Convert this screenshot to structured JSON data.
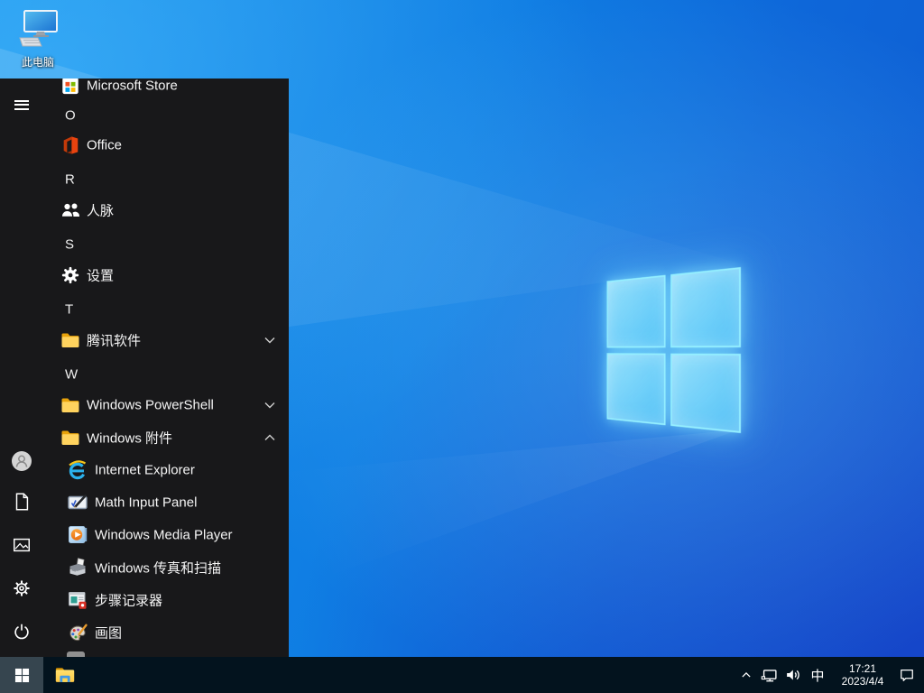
{
  "desktop": {
    "this_pc_label": "此电脑",
    "wallpaper": "windows10-light-blue-hero",
    "colors": {
      "base_blue": "#0f7de3",
      "logo_border": "#96f0ff",
      "dark_corner": "#173ec6"
    }
  },
  "start_menu": {
    "colors": {
      "background": "#18181a",
      "text": "#f5f5f5"
    },
    "rail": [
      {
        "icon": "hamburger-menu-icon"
      },
      {
        "icon": "user-avatar-icon"
      },
      {
        "icon": "documents-icon"
      },
      {
        "icon": "pictures-icon"
      },
      {
        "icon": "settings-gear-icon"
      },
      {
        "icon": "power-icon"
      }
    ],
    "items": [
      {
        "type": "app",
        "label": "Microsoft Store",
        "icon": "microsoft-store-icon"
      },
      {
        "type": "section",
        "label": "O"
      },
      {
        "type": "app",
        "label": "Office",
        "icon": "office-icon"
      },
      {
        "type": "section",
        "label": "R"
      },
      {
        "type": "app",
        "label": "人脉",
        "icon": "people-icon"
      },
      {
        "type": "section",
        "label": "S"
      },
      {
        "type": "app",
        "label": "设置",
        "icon": "settings-icon"
      },
      {
        "type": "section",
        "label": "T"
      },
      {
        "type": "folder",
        "label": "腾讯软件",
        "icon": "folder-icon",
        "state": "collapsed"
      },
      {
        "type": "section",
        "label": "W"
      },
      {
        "type": "folder",
        "label": "Windows PowerShell",
        "icon": "folder-icon",
        "state": "collapsed"
      },
      {
        "type": "folder",
        "label": "Windows 附件",
        "icon": "folder-icon",
        "state": "expanded"
      },
      {
        "type": "app",
        "label": "Internet Explorer",
        "icon": "internet-explorer-icon",
        "indent": true
      },
      {
        "type": "app",
        "label": "Math Input Panel",
        "icon": "math-input-panel-icon",
        "indent": true
      },
      {
        "type": "app",
        "label": "Windows Media Player",
        "icon": "windows-media-player-icon",
        "indent": true
      },
      {
        "type": "app",
        "label": "Windows 传真和扫描",
        "icon": "fax-and-scan-icon",
        "indent": true
      },
      {
        "type": "app",
        "label": "步骤记录器",
        "icon": "steps-recorder-icon",
        "indent": true
      },
      {
        "type": "app",
        "label": "画图",
        "icon": "paint-icon",
        "indent": true
      }
    ]
  },
  "taskbar": {
    "colors": {
      "background": "#03131e",
      "start_button_active": "#36454f"
    },
    "flag_colors": [
      "#f25022",
      "#7fba00",
      "#00a4ef",
      "#ffb900"
    ],
    "tray": {
      "ime_label": "中",
      "time": "17:21",
      "date": "2023/4/4"
    }
  }
}
